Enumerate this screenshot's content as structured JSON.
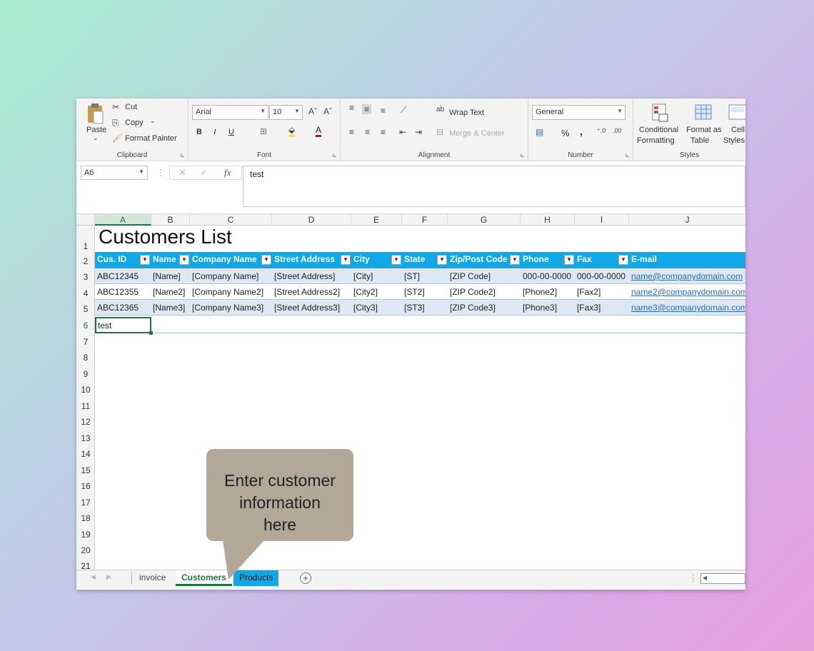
{
  "ribbon": {
    "clipboard": {
      "label": "Clipboard",
      "paste": "Paste",
      "cut": "Cut",
      "copy": "Copy",
      "format_painter": "Format Painter"
    },
    "font": {
      "label": "Font",
      "family": "Arial",
      "size": "10",
      "bold": "B",
      "italic": "I",
      "underline": "U"
    },
    "alignment": {
      "label": "Alignment",
      "wrap_text": "Wrap Text",
      "merge_center": "Merge & Center"
    },
    "number": {
      "label": "Number",
      "format": "General",
      "percent": "%",
      "comma": ","
    },
    "styles": {
      "label": "Styles",
      "conditional": "Conditional",
      "formatting": "Formatting",
      "format_as": "Format as",
      "table": "Table",
      "cell": "Cell",
      "styles": "Styles"
    }
  },
  "formula_bar": {
    "name_box": "A6",
    "fx": "fx",
    "value": "test"
  },
  "columns": [
    "A",
    "B",
    "C",
    "D",
    "E",
    "F",
    "G",
    "H",
    "I",
    "J"
  ],
  "rows": [
    "1",
    "2",
    "3",
    "4",
    "5",
    "6",
    "7",
    "8",
    "9",
    "10",
    "11",
    "12",
    "13",
    "14",
    "15",
    "16",
    "17",
    "18",
    "19",
    "20",
    "21"
  ],
  "sheet": {
    "title": "Customers List",
    "headers": [
      "Cus. ID",
      "Name",
      "Company Name",
      "Street Address",
      "City",
      "State",
      "Zip/Post Code",
      "Phone",
      "Fax",
      "E-mail"
    ],
    "data": [
      [
        "ABC12345",
        "[Name]",
        "[Company Name]",
        "[Street Address]",
        "[City]",
        "[ST]",
        "[ZIP Code]",
        "000-00-0000",
        "000-00-0000",
        "name@companydomain.com"
      ],
      [
        "ABC12355",
        "[Name2]",
        "[Company Name2]",
        "[Street Address2]",
        "[City2]",
        "[ST2]",
        "[ZIP Code2]",
        "[Phone2]",
        "[Fax2]",
        "name2@companydomain.com"
      ],
      [
        "ABC12365",
        "[Name3]",
        "[Company Name3]",
        "[Street Address3]",
        "[City3]",
        "[ST3]",
        "[ZIP Code3]",
        "[Phone3]",
        "[Fax3]",
        "name3@companydomain.com"
      ]
    ],
    "active_cell_value": "test"
  },
  "tabs": {
    "invoice": "invoice",
    "customers": "Customers",
    "products": "Products",
    "add": "+"
  },
  "callout": {
    "line1": "Enter customer",
    "line2": "information",
    "line3": "here"
  },
  "colors": {
    "header_blue": "#11a8e8",
    "band": "#dce9f5",
    "excel_green": "#217346",
    "callout": "#b3a898"
  }
}
